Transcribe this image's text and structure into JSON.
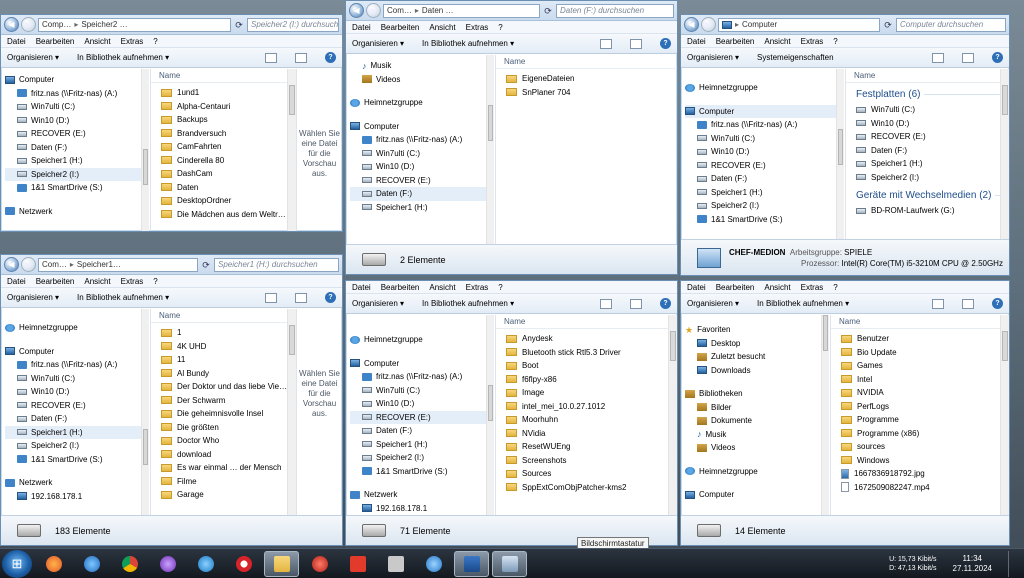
{
  "menu": [
    "Datei",
    "Bearbeiten",
    "Ansicht",
    "Extras",
    "?"
  ],
  "toolbar": {
    "organize": "Organisieren ▾",
    "library": "In Bibliothek aufnehmen ▾",
    "sysprops": "Systemeigenschaften"
  },
  "w1": {
    "address": [
      "Comp…",
      "Speicher2 …"
    ],
    "search": "Speicher2 (I:) durchsuchen",
    "nav": [
      "Computer",
      "fritz.nas (\\\\Fritz-nas) (A:)",
      "Win7ulti (C:)",
      "Win10 (D:)",
      "RECOVER (E:)",
      "Daten (F:)",
      "Speicher1 (H:)",
      "Speicher2 (I:)",
      "1&1 SmartDrive (S:)",
      "Netzwerk"
    ],
    "col": "Name",
    "items": [
      "1und1",
      "Alpha-Centauri",
      "Backups",
      "Brandversuch",
      "CamFahrten",
      "Cinderella 80",
      "DashCam",
      "Daten",
      "DesktopOrdner",
      "Die Mädchen aus dem Weltr…"
    ],
    "preview": "Wählen Sie eine Datei für die Vorschau aus."
  },
  "w2": {
    "address": [
      "Com…",
      "Speicher1…"
    ],
    "search": "Speicher1 (H:) durchsuchen",
    "nav": [
      "Heimnetzgruppe",
      "Computer",
      "fritz.nas (\\\\Fritz-nas) (A:)",
      "Win7ulti (C:)",
      "Win10 (D:)",
      "RECOVER (E:)",
      "Daten (F:)",
      "Speicher1 (H:)",
      "Speicher2 (I:)",
      "1&1 SmartDrive (S:)",
      "Netzwerk",
      "192.168.178.1"
    ],
    "col": "Name",
    "items": [
      "1",
      "4K UHD",
      "11",
      "Al Bundy",
      "Der Doktor und das liebe Vie…",
      "Der Schwarm",
      "Die geheimnisvolle Insel",
      "Die größten",
      "Doctor Who",
      "download",
      "Es war einmal … der Mensch",
      "Filme",
      "Garage"
    ],
    "preview": "Wählen Sie eine Datei für die Vorschau aus.",
    "status": "183 Elemente"
  },
  "w3": {
    "address": [
      "Com…",
      "Daten …"
    ],
    "search": "Daten (F:) durchsuchen",
    "nav": [
      "Musik",
      "Videos",
      "Heimnetzgruppe",
      "Computer",
      "fritz.nas (\\\\Fritz-nas) (A:)",
      "Win7ulti (C:)",
      "Win10 (D:)",
      "RECOVER (E:)",
      "Daten (F:)",
      "Speicher1 (H:)"
    ],
    "col": "Name",
    "items": [
      "EigeneDateien",
      "SnPlaner 704"
    ],
    "status": "2 Elemente"
  },
  "w4": {
    "nav": [
      "Heimnetzgruppe",
      "Computer",
      "fritz.nas (\\\\Fritz-nas) (A:)",
      "Win7ulti (C:)",
      "Win10 (D:)",
      "RECOVER (E:)",
      "Daten (F:)",
      "Speicher1 (H:)",
      "Speicher2 (I:)",
      "1&1 SmartDrive (S:)",
      "Netzwerk",
      "192.168.178.1"
    ],
    "col": "Name",
    "items": [
      "Anydesk",
      "Bluetooth stick Rtl5.3 Driver",
      "Boot",
      "f6flpy-x86",
      "Image",
      "intel_mei_10.0.27.1012",
      "Moorhuhn",
      "NVidia",
      "ResetWUEng",
      "Screenshots",
      "Sources",
      "SppExtComObjPatcher-kms2"
    ],
    "status": "71 Elemente"
  },
  "w5": {
    "address": [
      "Computer"
    ],
    "search": "Computer durchsuchen",
    "nav": [
      "Heimnetzgruppe",
      "Computer",
      "fritz.nas (\\\\Fritz-nas) (A:)",
      "Win7ulti (C:)",
      "Win10 (D:)",
      "RECOVER (E:)",
      "Daten (F:)",
      "Speicher1 (H:)",
      "Speicher2 (I:)",
      "1&1 SmartDrive (S:)"
    ],
    "col": "Name",
    "sec1": "Festplatten (6)",
    "drives": [
      "Win7ulti (C:)",
      "Win10 (D:)",
      "RECOVER (E:)",
      "Daten (F:)",
      "Speicher1 (H:)",
      "Speicher2 (I:)"
    ],
    "sec2": "Geräte mit Wechselmedien (2)",
    "removable": [
      "BD-ROM-Laufwerk (G:)"
    ],
    "pc": "CHEF-MEDION",
    "workgroup_label": "Arbeitsgruppe:",
    "workgroup": "SPIELE",
    "cpu_label": "Prozessor:",
    "cpu": "Intel(R) Core(TM) i5-3210M CPU @ 2.50GHz"
  },
  "w6": {
    "nav": [
      "Favoriten",
      "Desktop",
      "Zuletzt besucht",
      "Downloads",
      "Bibliotheken",
      "Bilder",
      "Dokumente",
      "Musik",
      "Videos",
      "Heimnetzgruppe",
      "Computer"
    ],
    "col": "Name",
    "items": [
      "Benutzer",
      "Bio Update",
      "Games",
      "Intel",
      "NVIDIA",
      "PerfLogs",
      "Programme",
      "Programme (x86)",
      "sources",
      "Windows"
    ],
    "files": [
      "1667836918792.jpg",
      "1672509082247.mp4"
    ],
    "status": "14 Elemente"
  },
  "taskbar": {
    "tooltip": "Bildschirmtastatur",
    "up_label": "U:",
    "down_label": "D:",
    "up": "15,73 Kibit/s",
    "down": "47,13 Kibit/s",
    "time": "11:34",
    "date": "27.11.2024",
    "apps": [
      "firefox-icon",
      "thunderbird-icon",
      "chrome-icon",
      "tor-icon",
      "ie-icon",
      "opera-icon",
      "explorer-icon",
      "app-red-icon",
      "anydesk-icon",
      "calculator-icon",
      "settings-icon",
      "monitor-icon",
      "keyboard-icon"
    ]
  },
  "colors": {
    "accent": "#1e4e8c",
    "folder": "#e3b53f",
    "taskbar": "#14191f"
  }
}
